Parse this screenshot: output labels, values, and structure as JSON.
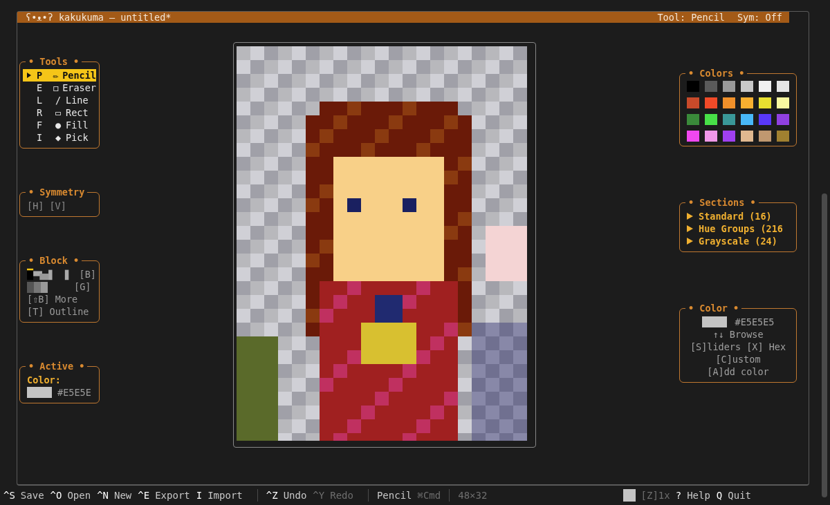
{
  "title_bar": {
    "app_title": "ʕ•ᴥ•ʔ kakukuma — untitled*",
    "tool_status": "Tool: Pencil",
    "sym_status": "Sym: Off"
  },
  "tools_panel": {
    "title": "• Tools •",
    "items": [
      {
        "key": "P",
        "icon": "✏",
        "label": "Pencil",
        "selected": true
      },
      {
        "key": "E",
        "icon": "◻",
        "label": "Eraser",
        "selected": false
      },
      {
        "key": "L",
        "icon": "/",
        "label": "Line",
        "selected": false
      },
      {
        "key": "R",
        "icon": "▭",
        "label": "Rect",
        "selected": false
      },
      {
        "key": "F",
        "icon": "●",
        "label": "Fill",
        "selected": false
      },
      {
        "key": "I",
        "icon": "◆",
        "label": "Pick",
        "selected": false
      }
    ]
  },
  "symmetry_panel": {
    "title": "• Symmetry",
    "options": [
      {
        "label": "[H]",
        "on": false
      },
      {
        "label": "[V]",
        "on": false
      }
    ]
  },
  "block_panel": {
    "title": "• Block •",
    "rows": [
      {
        "kind": "blocks",
        "label": "[B]"
      },
      {
        "kind": "shades",
        "label": "[G]"
      },
      {
        "kind": "text",
        "label": "[⇧B] More"
      },
      {
        "kind": "text",
        "label": "[T] Outline"
      }
    ]
  },
  "active_panel": {
    "title": "• Active •",
    "label": "Color:",
    "hex": "#E5E5E"
  },
  "colors_panel": {
    "title": "• Colors •",
    "swatches": [
      {
        "color": "#000000"
      },
      {
        "color": "#5a5a5a"
      },
      {
        "color": "#9a9a9a"
      },
      {
        "color": "#c8c8c8"
      },
      {
        "color": "#f0f0f0"
      },
      {
        "color": "#e6e6e6"
      },
      {
        "color": "#c84a2a"
      },
      {
        "color": "#f04a28"
      },
      {
        "color": "#f0902a"
      },
      {
        "color": "#f8b030"
      },
      {
        "color": "#e8e030"
      },
      {
        "color": "#f8f8a0"
      },
      {
        "color": "#3a8a3a"
      },
      {
        "color": "#48e048"
      },
      {
        "color": "#3a9898"
      },
      {
        "color": "#48b8f8"
      },
      {
        "color": "#5838f8"
      },
      {
        "color": "#9040e0"
      },
      {
        "color": "#f048f0"
      },
      {
        "color": "#f098e8"
      },
      {
        "color": "#a040f0"
      },
      {
        "color": "#e0b890"
      },
      {
        "color": "#c09870"
      },
      {
        "color": "#a08030"
      }
    ]
  },
  "sections_panel": {
    "title": "• Sections •",
    "items": [
      "Standard (16)",
      "Hue Groups (216",
      "Grayscale (24)"
    ]
  },
  "color_panel": {
    "title": "• Color •",
    "hex": "#E5E5E5",
    "lines": [
      "↑↓ Browse",
      "[S]liders [X] Hex",
      "[C]ustom",
      "[A]dd color"
    ]
  },
  "status_bar": {
    "groups": [
      [
        {
          "key": "^S",
          "label": "Save",
          "disabled": false
        },
        {
          "key": "^O",
          "label": "Open",
          "disabled": false
        },
        {
          "key": "^N",
          "label": "New",
          "disabled": false
        },
        {
          "key": "^E",
          "label": "Export",
          "disabled": false
        },
        {
          "key": "I",
          "label": "Import",
          "disabled": false
        }
      ],
      [
        {
          "key": "^Z",
          "label": "Undo",
          "disabled": false
        },
        {
          "key": "^Y",
          "label": "Redo",
          "disabled": true
        }
      ]
    ],
    "tool": "Pencil",
    "modifier": "⌘Cmd",
    "size": "48×32",
    "zoom": "[Z]1x",
    "help": [
      {
        "key": "?",
        "label": "Help",
        "disabled": false
      },
      {
        "key": "Q",
        "label": "Quit",
        "disabled": false
      }
    ]
  }
}
